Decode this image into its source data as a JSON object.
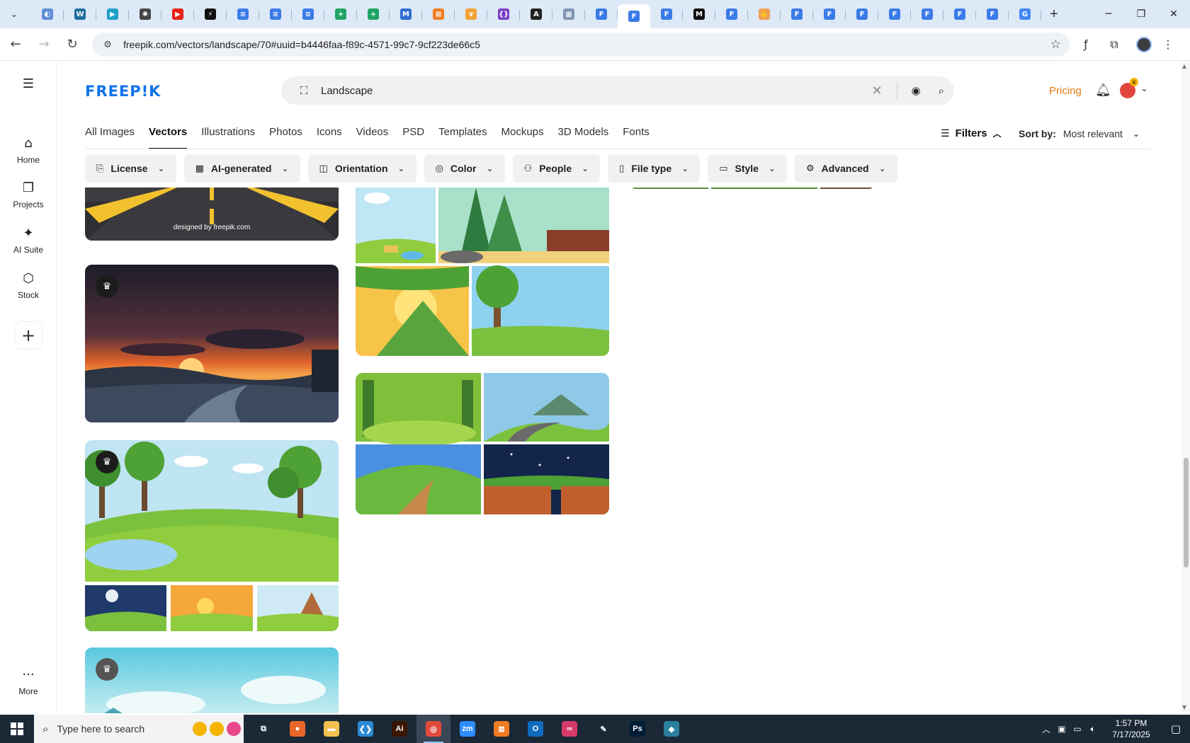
{
  "browser": {
    "tabs": [
      {
        "icon": "globe-icon",
        "color": "#5f8fd6",
        "glyph": "◐"
      },
      {
        "icon": "wordpress-icon",
        "color": "#1f6f9e",
        "glyph": "W"
      },
      {
        "icon": "play-icon",
        "color": "#1ea1c7",
        "glyph": "▶"
      },
      {
        "icon": "openai-icon",
        "color": "#444444",
        "glyph": "✺"
      },
      {
        "icon": "youtube-icon",
        "color": "#e62117",
        "glyph": "▶"
      },
      {
        "icon": "bolt-icon",
        "color": "#111111",
        "glyph": "⚡"
      },
      {
        "icon": "docs-icon",
        "color": "#3b7be8",
        "glyph": "≡"
      },
      {
        "icon": "docs-icon",
        "color": "#3b7be8",
        "glyph": "≡"
      },
      {
        "icon": "docs-icon",
        "color": "#3b7be8",
        "glyph": "≡"
      },
      {
        "icon": "sheets-icon",
        "color": "#1ea463",
        "glyph": "+"
      },
      {
        "icon": "sheets-icon",
        "color": "#1ea463",
        "glyph": "+"
      },
      {
        "icon": "ms-icon",
        "color": "#2f6bd1",
        "glyph": "M"
      },
      {
        "icon": "xampp-icon",
        "color": "#f07c22",
        "glyph": "⊠"
      },
      {
        "icon": "chevron-icon",
        "color": "#f3a336",
        "glyph": "∨"
      },
      {
        "icon": "code-icon",
        "color": "#7a3fc4",
        "glyph": "{}"
      },
      {
        "icon": "angular-icon",
        "color": "#222222",
        "glyph": "A"
      },
      {
        "icon": "grid-icon",
        "color": "#7f95b3",
        "glyph": "▦"
      },
      {
        "icon": "form-icon",
        "color": "#3b7be8",
        "glyph": "F"
      },
      {
        "icon": "form-icon",
        "color": "#3b7be8",
        "glyph": "F",
        "active": true
      },
      {
        "icon": "form-icon",
        "color": "#3b7be8",
        "glyph": "F"
      },
      {
        "icon": "medium-icon",
        "color": "#111111",
        "glyph": "M"
      },
      {
        "icon": "form-icon",
        "color": "#3b7be8",
        "glyph": "F"
      },
      {
        "icon": "hand-icon",
        "color": "#f0a055",
        "glyph": "✋"
      },
      {
        "icon": "form-icon",
        "color": "#3b7be8",
        "glyph": "F"
      },
      {
        "icon": "form-icon",
        "color": "#3b7be8",
        "glyph": "F"
      },
      {
        "icon": "form-icon",
        "color": "#3b7be8",
        "glyph": "F"
      },
      {
        "icon": "form-icon",
        "color": "#3b7be8",
        "glyph": "F"
      },
      {
        "icon": "form-icon",
        "color": "#3b7be8",
        "glyph": "F"
      },
      {
        "icon": "form-icon",
        "color": "#3b7be8",
        "glyph": "F"
      },
      {
        "icon": "form-icon",
        "color": "#3b7be8",
        "glyph": "F"
      },
      {
        "icon": "google-icon",
        "color": "#4285f4",
        "glyph": "G"
      }
    ],
    "url": "freepik.com/vectors/landscape/70#uuid=b4446faa-f89c-4571-99c7-9cf223de66c5"
  },
  "rail": {
    "items": [
      {
        "label": "Home",
        "icon": "home-icon",
        "glyph": "⌂"
      },
      {
        "label": "Projects",
        "icon": "projects-icon",
        "glyph": "❐"
      },
      {
        "label": "AI Suite",
        "icon": "sparkle-icon",
        "glyph": "✦"
      },
      {
        "label": "Stock",
        "icon": "stock-icon",
        "glyph": "⬡"
      }
    ],
    "more_label": "More"
  },
  "header": {
    "logo": "FREEP!K",
    "search_value": "Landscape",
    "pricing": "Pricing"
  },
  "categories": [
    {
      "label": "All Images"
    },
    {
      "label": "Vectors",
      "active": true
    },
    {
      "label": "Illustrations"
    },
    {
      "label": "Photos"
    },
    {
      "label": "Icons"
    },
    {
      "label": "Videos"
    },
    {
      "label": "PSD"
    },
    {
      "label": "Templates"
    },
    {
      "label": "Mockups"
    },
    {
      "label": "3D Models"
    },
    {
      "label": "Fonts"
    }
  ],
  "filters": {
    "label": "Filters",
    "sort_label": "Sort by:",
    "sort_value": "Most relevant"
  },
  "chips": [
    {
      "label": "License",
      "icon": "license-icon"
    },
    {
      "label": "AI-generated",
      "icon": "ai-icon"
    },
    {
      "label": "Orientation",
      "icon": "orientation-icon"
    },
    {
      "label": "Color",
      "icon": "palette-icon"
    },
    {
      "label": "People",
      "icon": "people-icon"
    },
    {
      "label": "File type",
      "icon": "file-icon"
    },
    {
      "label": "Style",
      "icon": "brush-icon"
    },
    {
      "label": "Advanced",
      "icon": "settings-icon"
    }
  ],
  "grid": {
    "watermark": "designed by  freepik.com"
  },
  "taskbar": {
    "search_placeholder": "Type here to search",
    "apps": [
      {
        "icon": "task-view-icon",
        "color": "#1b2836",
        "glyph": "⧉"
      },
      {
        "icon": "firefox-icon",
        "color": "#e8662a",
        "glyph": "●"
      },
      {
        "icon": "explorer-icon",
        "color": "#f2c14e",
        "glyph": "▬"
      },
      {
        "icon": "vscode-icon",
        "color": "#2a8ad4",
        "glyph": "❮❯"
      },
      {
        "icon": "illustrator-icon",
        "color": "#3a1500",
        "glyph": "Ai"
      },
      {
        "icon": "chrome-icon",
        "color": "#e24a3b",
        "glyph": "◎",
        "active": true
      },
      {
        "icon": "zoom-icon",
        "color": "#2d8cff",
        "glyph": "zm"
      },
      {
        "icon": "xampp-icon",
        "color": "#f07c22",
        "glyph": "⊠"
      },
      {
        "icon": "outlook-icon",
        "color": "#0f6cbd",
        "glyph": "O"
      },
      {
        "icon": "creative-cloud-icon",
        "color": "#d63a6b",
        "glyph": "∞"
      },
      {
        "icon": "pen-icon",
        "color": "#1b2836",
        "glyph": "✎"
      },
      {
        "icon": "photoshop-icon",
        "color": "#001e36",
        "glyph": "Ps"
      },
      {
        "icon": "app-icon",
        "color": "#2a7f9e",
        "glyph": "◆"
      }
    ],
    "time": "1:57 PM",
    "date": "7/17/2025"
  }
}
